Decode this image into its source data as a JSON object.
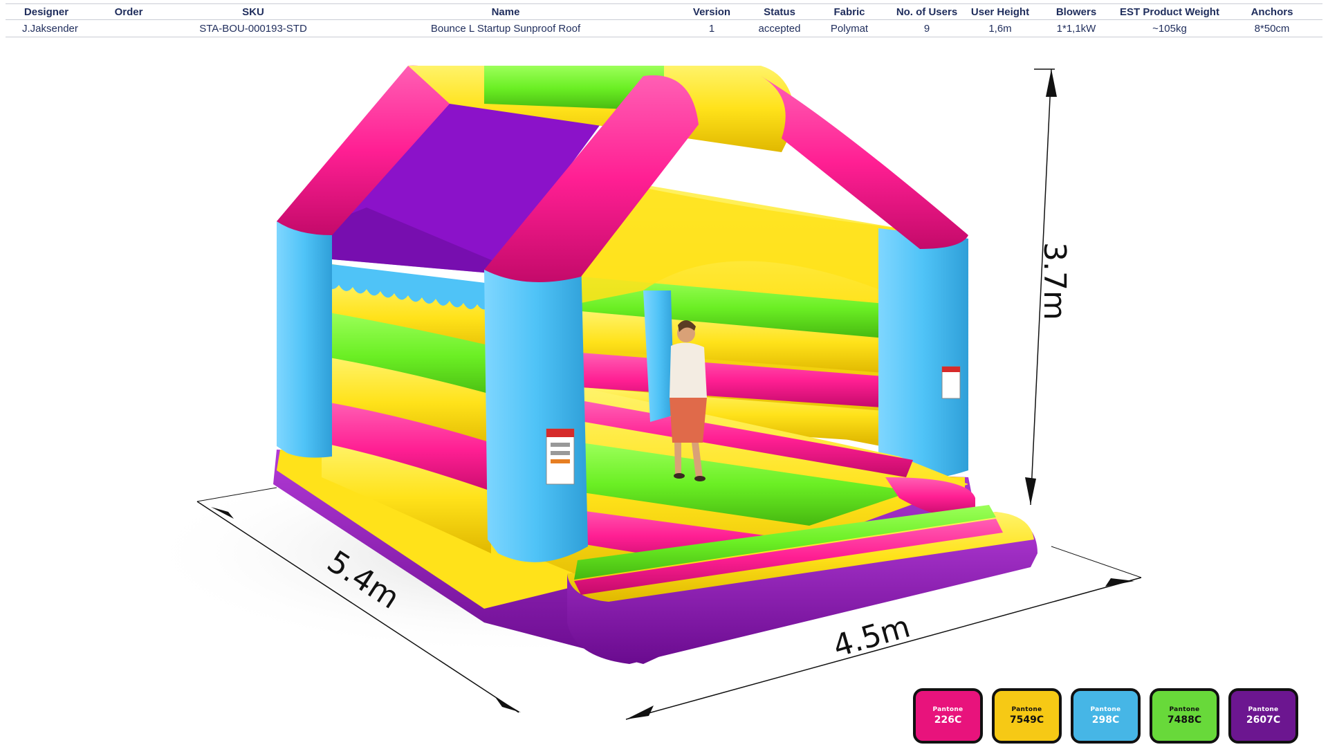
{
  "table": {
    "headers": [
      "Designer",
      "Order",
      "SKU",
      "Name",
      "Version",
      "Status",
      "Fabric",
      "No. of Users",
      "User  Height",
      "Blowers",
      "EST Product Weight",
      "Anchors"
    ],
    "row": [
      "J.Jaksender",
      "",
      "STA-BOU-000193-STD",
      "Bounce L Startup Sunproof Roof",
      "1",
      "accepted",
      "Polymat",
      "9",
      "1,6m",
      "1*1,1kW",
      "~105kg",
      "8*50cm"
    ]
  },
  "dimensions": {
    "height": "3.7m",
    "length": "5.4m",
    "width": "4.5m"
  },
  "swatches": [
    {
      "brand": "Pantone",
      "code": "226C",
      "color": "#e8137c"
    },
    {
      "brand": "Pantone",
      "code": "7549C",
      "color": "#f6c915"
    },
    {
      "brand": "Pantone",
      "code": "298C",
      "color": "#46b6e6"
    },
    {
      "brand": "Pantone",
      "code": "7488C",
      "color": "#68d93a"
    },
    {
      "brand": "Pantone",
      "code": "2607C",
      "color": "#6c1690"
    }
  ]
}
